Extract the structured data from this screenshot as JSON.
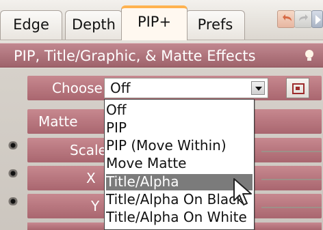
{
  "tabs": [
    {
      "label": "Edge"
    },
    {
      "label": "Depth"
    },
    {
      "label": "PIP+"
    },
    {
      "label": "Prefs"
    }
  ],
  "toolbar": {
    "undo_icon": "undo-icon",
    "redo_icon": "redo-icon",
    "play_icon": "play-icon"
  },
  "panel": {
    "title": "PIP, Title/Graphic, & Matte Effects",
    "info_icon": "lightbulb-icon",
    "choose_label": "Choose",
    "choose_value": "Off",
    "matte_label": "Matte",
    "scale_label": "Scale",
    "x_label": "X",
    "y_label": "Y"
  },
  "dropdown": {
    "options": [
      "Off",
      "PIP",
      "PIP (Move Within)",
      "Move Matte",
      "Title/Alpha",
      "Title/Alpha On Black",
      "Title/Alpha On White"
    ],
    "highlighted": "Title/Alpha"
  },
  "colors": {
    "accent": "#ffb24f",
    "panel_band": "#b16f77",
    "selection": "#7b7b7b"
  }
}
